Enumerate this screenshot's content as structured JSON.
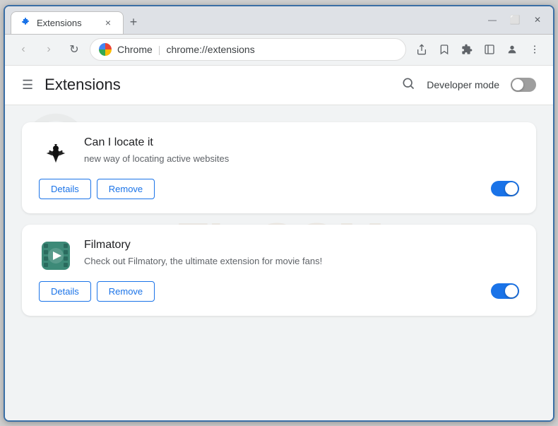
{
  "window": {
    "tab_title": "Extensions",
    "tab_close_symbol": "×",
    "new_tab_symbol": "+",
    "win_minimize": "—",
    "win_maximize": "⬜",
    "win_close": "✕",
    "win_restore": "⊟"
  },
  "navbar": {
    "back": "‹",
    "forward": "›",
    "reload": "↻",
    "chrome_label": "Chrome",
    "url": "chrome://extensions",
    "share_icon": "⬆",
    "star_icon": "☆",
    "extensions_icon": "⧉",
    "sidebar_icon": "▣",
    "profile_icon": "◯",
    "menu_icon": "⋮"
  },
  "page": {
    "menu_icon": "☰",
    "title": "Extensions",
    "search_icon": "🔍",
    "developer_mode_label": "Developer mode",
    "developer_mode_on": false
  },
  "extensions": [
    {
      "id": "can-locate-it",
      "name": "Can I locate it",
      "description": "new way of locating active websites",
      "details_label": "Details",
      "remove_label": "Remove",
      "enabled": true
    },
    {
      "id": "filmatory",
      "name": "Filmatory",
      "description": "Check out Filmatory, the ultimate extension for movie fans!",
      "details_label": "Details",
      "remove_label": "Remove",
      "enabled": true
    }
  ],
  "watermark": "FL.COM"
}
